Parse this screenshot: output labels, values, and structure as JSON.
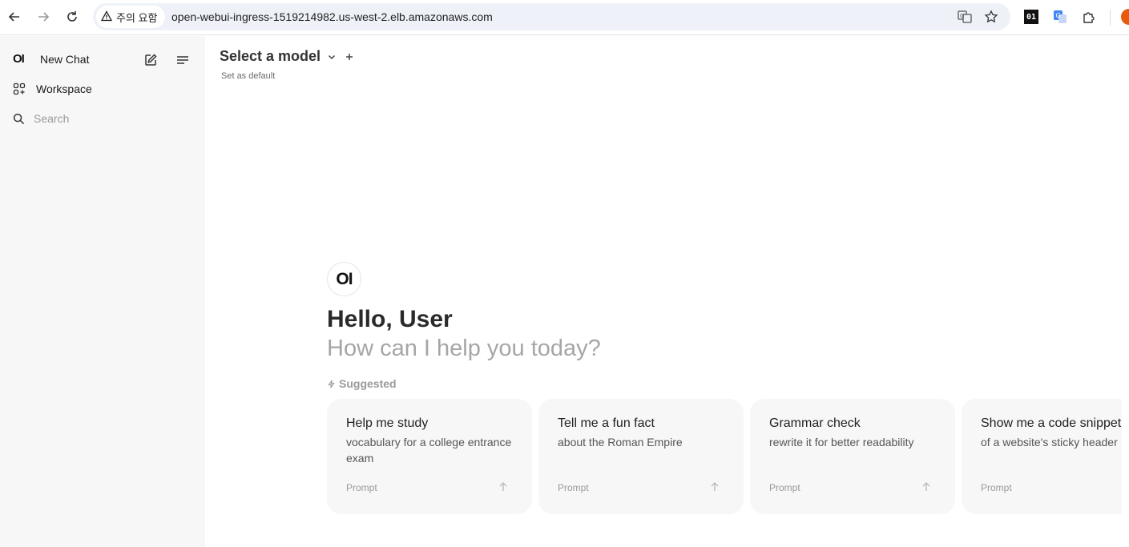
{
  "browser": {
    "security_chip": "주의 요함",
    "url": "open-webui-ingress-1519214982.us-west-2.elb.amazonaws.com",
    "extensions": [
      "01-extension-icon",
      "google-translate-icon",
      "puzzle-icon",
      "profile-icon"
    ]
  },
  "sidebar": {
    "logo": "OI",
    "new_chat": "New Chat",
    "workspace": "Workspace",
    "search_placeholder": "Search"
  },
  "main": {
    "model_selector": "Select a model",
    "set_default": "Set as default",
    "logo": "OI",
    "greeting": "Hello, User",
    "subgreeting": "How can I help you today?",
    "suggested_label": "Suggested",
    "suggestions": [
      {
        "title": "Help me study",
        "desc": "vocabulary for a college entrance exam",
        "foot": "Prompt"
      },
      {
        "title": "Tell me a fun fact",
        "desc": "about the Roman Empire",
        "foot": "Prompt"
      },
      {
        "title": "Grammar check",
        "desc": "rewrite it for better readability",
        "foot": "Prompt"
      },
      {
        "title": "Show me a code snippet",
        "desc": "of a website's sticky header",
        "foot": "Prompt"
      }
    ]
  },
  "colors": {
    "sidebar_bg": "#f7f7f7",
    "card_bg": "#f7f7f7",
    "omnibox_bg": "#eef2f8",
    "muted_text": "#a6a6a6"
  }
}
